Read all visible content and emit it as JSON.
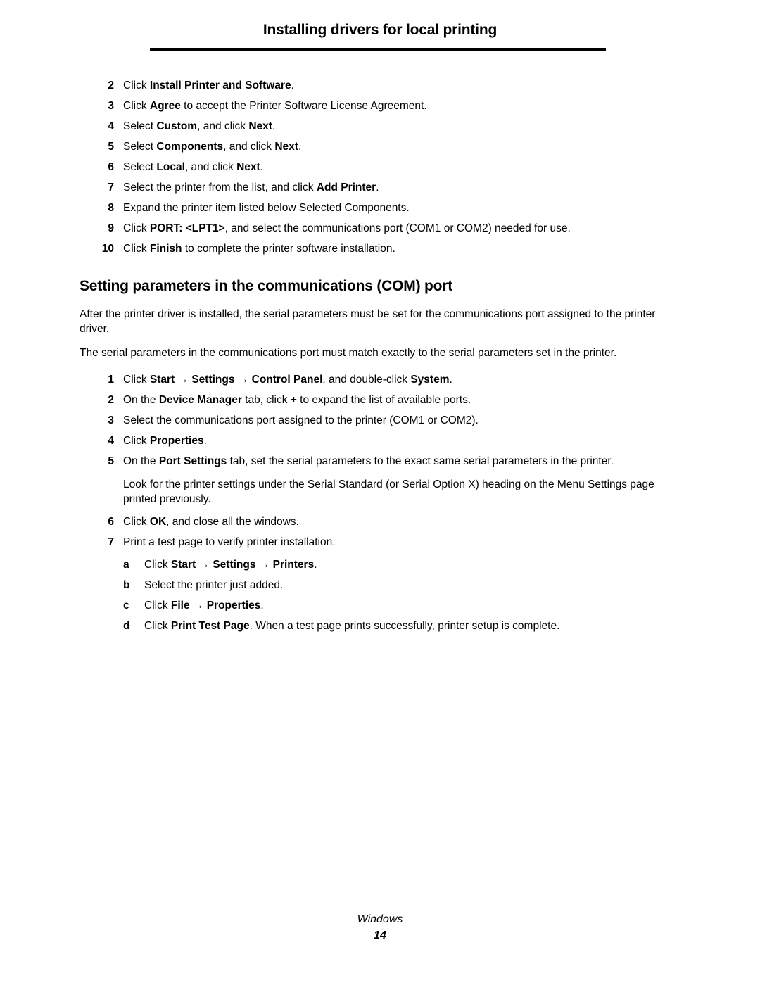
{
  "header": {
    "title": "Installing drivers for local printing"
  },
  "list_one": {
    "items": [
      {
        "num": "2",
        "html": "Click <b>Install Printer and Software</b>."
      },
      {
        "num": "3",
        "html": "Click <b>Agree</b> to accept the Printer Software License Agreement."
      },
      {
        "num": "4",
        "html": "Select <b>Custom</b>, and click <b>Next</b>."
      },
      {
        "num": "5",
        "html": "Select <b>Components</b>, and click <b>Next</b>."
      },
      {
        "num": "6",
        "html": "Select <b>Local</b>, and click <b>Next</b>."
      },
      {
        "num": "7",
        "html": "Select the printer from the list, and click <b>Add Printer</b>."
      },
      {
        "num": "8",
        "html": "Expand the printer item listed below Selected Components."
      },
      {
        "num": "9",
        "html": "Click <b>PORT: &lt;LPT1&gt;</b>, and select the communications port (COM1 or COM2) needed for use."
      },
      {
        "num": "10",
        "html": "Click <b>Finish</b> to complete the printer software installation."
      }
    ]
  },
  "section": {
    "heading": "Setting parameters in the communications (COM) port",
    "paragraph_1": "After the printer driver is installed, the serial parameters must be set for the communications port assigned to the printer driver.",
    "paragraph_2": "The serial parameters in the communications port must match exactly to the serial parameters set in the printer."
  },
  "list_two": {
    "items": [
      {
        "num": "1",
        "html": "Click <b>Start</b> <b class=\"arrow\">&#8594;</b> <b>Settings</b> <b class=\"arrow\">&#8594;</b> <b>Control Panel</b>, and double-click <b>System</b>."
      },
      {
        "num": "2",
        "html": "On the <b>Device Manager</b> tab, click <b>+</b> to expand the list of available ports."
      },
      {
        "num": "3",
        "html": "Select the communications port assigned to the printer (COM1 or COM2)."
      },
      {
        "num": "4",
        "html": "Click <b>Properties</b>."
      },
      {
        "num": "5",
        "html": "On the <b>Port Settings</b> tab, set the serial parameters to the exact same serial parameters in the printer."
      }
    ],
    "note": "Look for the printer settings under the Serial Standard (or Serial Option X) heading on the Menu Settings page printed previously.",
    "items_after_note": [
      {
        "num": "6",
        "html": "Click <b>OK</b>, and close all the windows."
      },
      {
        "num": "7",
        "html": "Print a test page to verify printer installation."
      }
    ],
    "substeps": [
      {
        "num": "a",
        "html": "Click <b>Start</b> <b class=\"arrow\">&#8594;</b> <b>Settings</b> <b class=\"arrow\">&#8594;</b> <b>Printers</b>."
      },
      {
        "num": "b",
        "html": "Select the printer just added."
      },
      {
        "num": "c",
        "html": "Click <b>File</b> <b class=\"arrow\">&#8594;</b> <b>Properties</b>."
      },
      {
        "num": "d",
        "html": "Click <b>Print Test Page</b>. When a test page prints successfully, printer setup is complete."
      }
    ]
  },
  "footer": {
    "label": "Windows",
    "page_number": "14"
  }
}
